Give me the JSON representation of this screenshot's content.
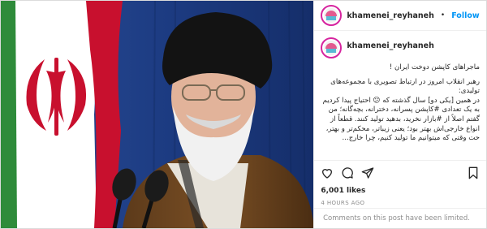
{
  "post": {
    "username": "khamenei_reyhaneh",
    "follow_label": "Follow",
    "dot": "•",
    "caption_title": "ماجراهای کاپشن دوخت ایران !",
    "caption_body": "رهبر انقلاب امروز در ارتباط تصویری با مجموعه‌های تولیدی:\nدر همین [یکی دو] سال گذشته که 😕 احتیاج پیدا کردیم به یک تعدادی #کاپشن پسرانه، دخترانه، بچه‌گانه؛ من گفتم اصلاً از #بازار نخرید، بدهید تولید کنند. قطعاً از انواع خارجی‌اش بهتر بود؛ یعنی زیباتر، محکم‌تر و بهتر، حت وقتی که میتوانیم ما تولید کنیم، چرا خارج...",
    "likes": "6,001 likes",
    "timestamp": "4 HOURS AGO",
    "comments_limited": "Comments on this post have been limited."
  },
  "icons": {
    "like": "heart-icon",
    "comment": "comment-icon",
    "share": "share-icon",
    "save": "bookmark-icon"
  },
  "colors": {
    "link": "#0095f6",
    "hashtag": "#00376b",
    "flag_red": "#c8102e",
    "curtain_blue": "#1e3f86"
  }
}
